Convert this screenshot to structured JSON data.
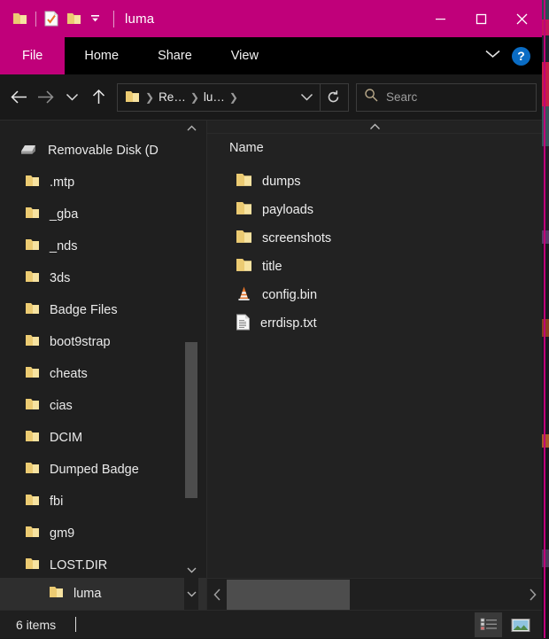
{
  "window": {
    "title": "luma",
    "accent_color": "#c0007a",
    "background": "#202020"
  },
  "quick_access": {
    "items": [
      {
        "name": "explorer-folder-icon",
        "label": "Explorer"
      },
      {
        "name": "properties-icon",
        "label": "Properties"
      },
      {
        "name": "new-folder-icon",
        "label": "New folder"
      },
      {
        "name": "customize-qat-icon",
        "label": "Customize Quick Access Toolbar"
      }
    ]
  },
  "window_controls": {
    "minimize": "—",
    "maximize": "□",
    "close": "✕"
  },
  "ribbon": {
    "tabs": [
      {
        "label": "File",
        "active": true
      },
      {
        "label": "Home",
        "active": false
      },
      {
        "label": "Share",
        "active": false
      },
      {
        "label": "View",
        "active": false
      }
    ],
    "expand_label": "∨",
    "help_label": "?"
  },
  "address_bar": {
    "back": "←",
    "forward": "→",
    "recent": "∨",
    "up": "↑",
    "breadcrumbs": [
      {
        "label": "Re…"
      },
      {
        "label": "lu…"
      }
    ],
    "dropdown": "∨",
    "refresh": "↻"
  },
  "search": {
    "placeholder": "Searc",
    "icon": "search-icon"
  },
  "navigation_pane": {
    "scroll_up": "⌃",
    "scroll_down": "⌄",
    "items": [
      {
        "label": "Removable Disk (D",
        "icon": "drive-icon",
        "selected": false,
        "root": true
      },
      {
        "label": ".mtp",
        "icon": "folder-icon",
        "selected": false
      },
      {
        "label": "_gba",
        "icon": "folder-icon",
        "selected": false
      },
      {
        "label": "_nds",
        "icon": "folder-icon",
        "selected": false
      },
      {
        "label": "3ds",
        "icon": "folder-icon",
        "selected": false
      },
      {
        "label": "Badge Files",
        "icon": "folder-icon",
        "selected": false
      },
      {
        "label": "boot9strap",
        "icon": "folder-icon",
        "selected": false
      },
      {
        "label": "cheats",
        "icon": "folder-icon",
        "selected": false
      },
      {
        "label": "cias",
        "icon": "folder-icon",
        "selected": false
      },
      {
        "label": "DCIM",
        "icon": "folder-icon",
        "selected": false
      },
      {
        "label": "Dumped Badge",
        "icon": "folder-icon",
        "selected": false
      },
      {
        "label": "fbi",
        "icon": "folder-icon",
        "selected": false
      },
      {
        "label": "gm9",
        "icon": "folder-icon",
        "selected": false
      },
      {
        "label": "LOST.DIR",
        "icon": "folder-icon",
        "selected": false
      },
      {
        "label": "luma",
        "icon": "folder-icon",
        "selected": true
      }
    ]
  },
  "file_pane": {
    "scroll_up": "⌃",
    "column_header": "Name",
    "items": [
      {
        "label": "dumps",
        "icon": "folder-icon"
      },
      {
        "label": "payloads",
        "icon": "folder-icon"
      },
      {
        "label": "screenshots",
        "icon": "folder-icon"
      },
      {
        "label": "title",
        "icon": "folder-icon"
      },
      {
        "label": "config.bin",
        "icon": "vlc-cone-icon"
      },
      {
        "label": "errdisp.txt",
        "icon": "text-file-icon"
      }
    ]
  },
  "bottom_breadcrumb": {
    "label": "luma",
    "icon": "folder-icon",
    "chevron": "⌄"
  },
  "horizontal_scrollbar": {
    "left_arrow": "‹",
    "right_arrow": "›"
  },
  "status_bar": {
    "item_count": "6 items",
    "views": [
      {
        "name": "details-view",
        "active": true
      },
      {
        "name": "large-icons-view",
        "active": false
      }
    ]
  }
}
